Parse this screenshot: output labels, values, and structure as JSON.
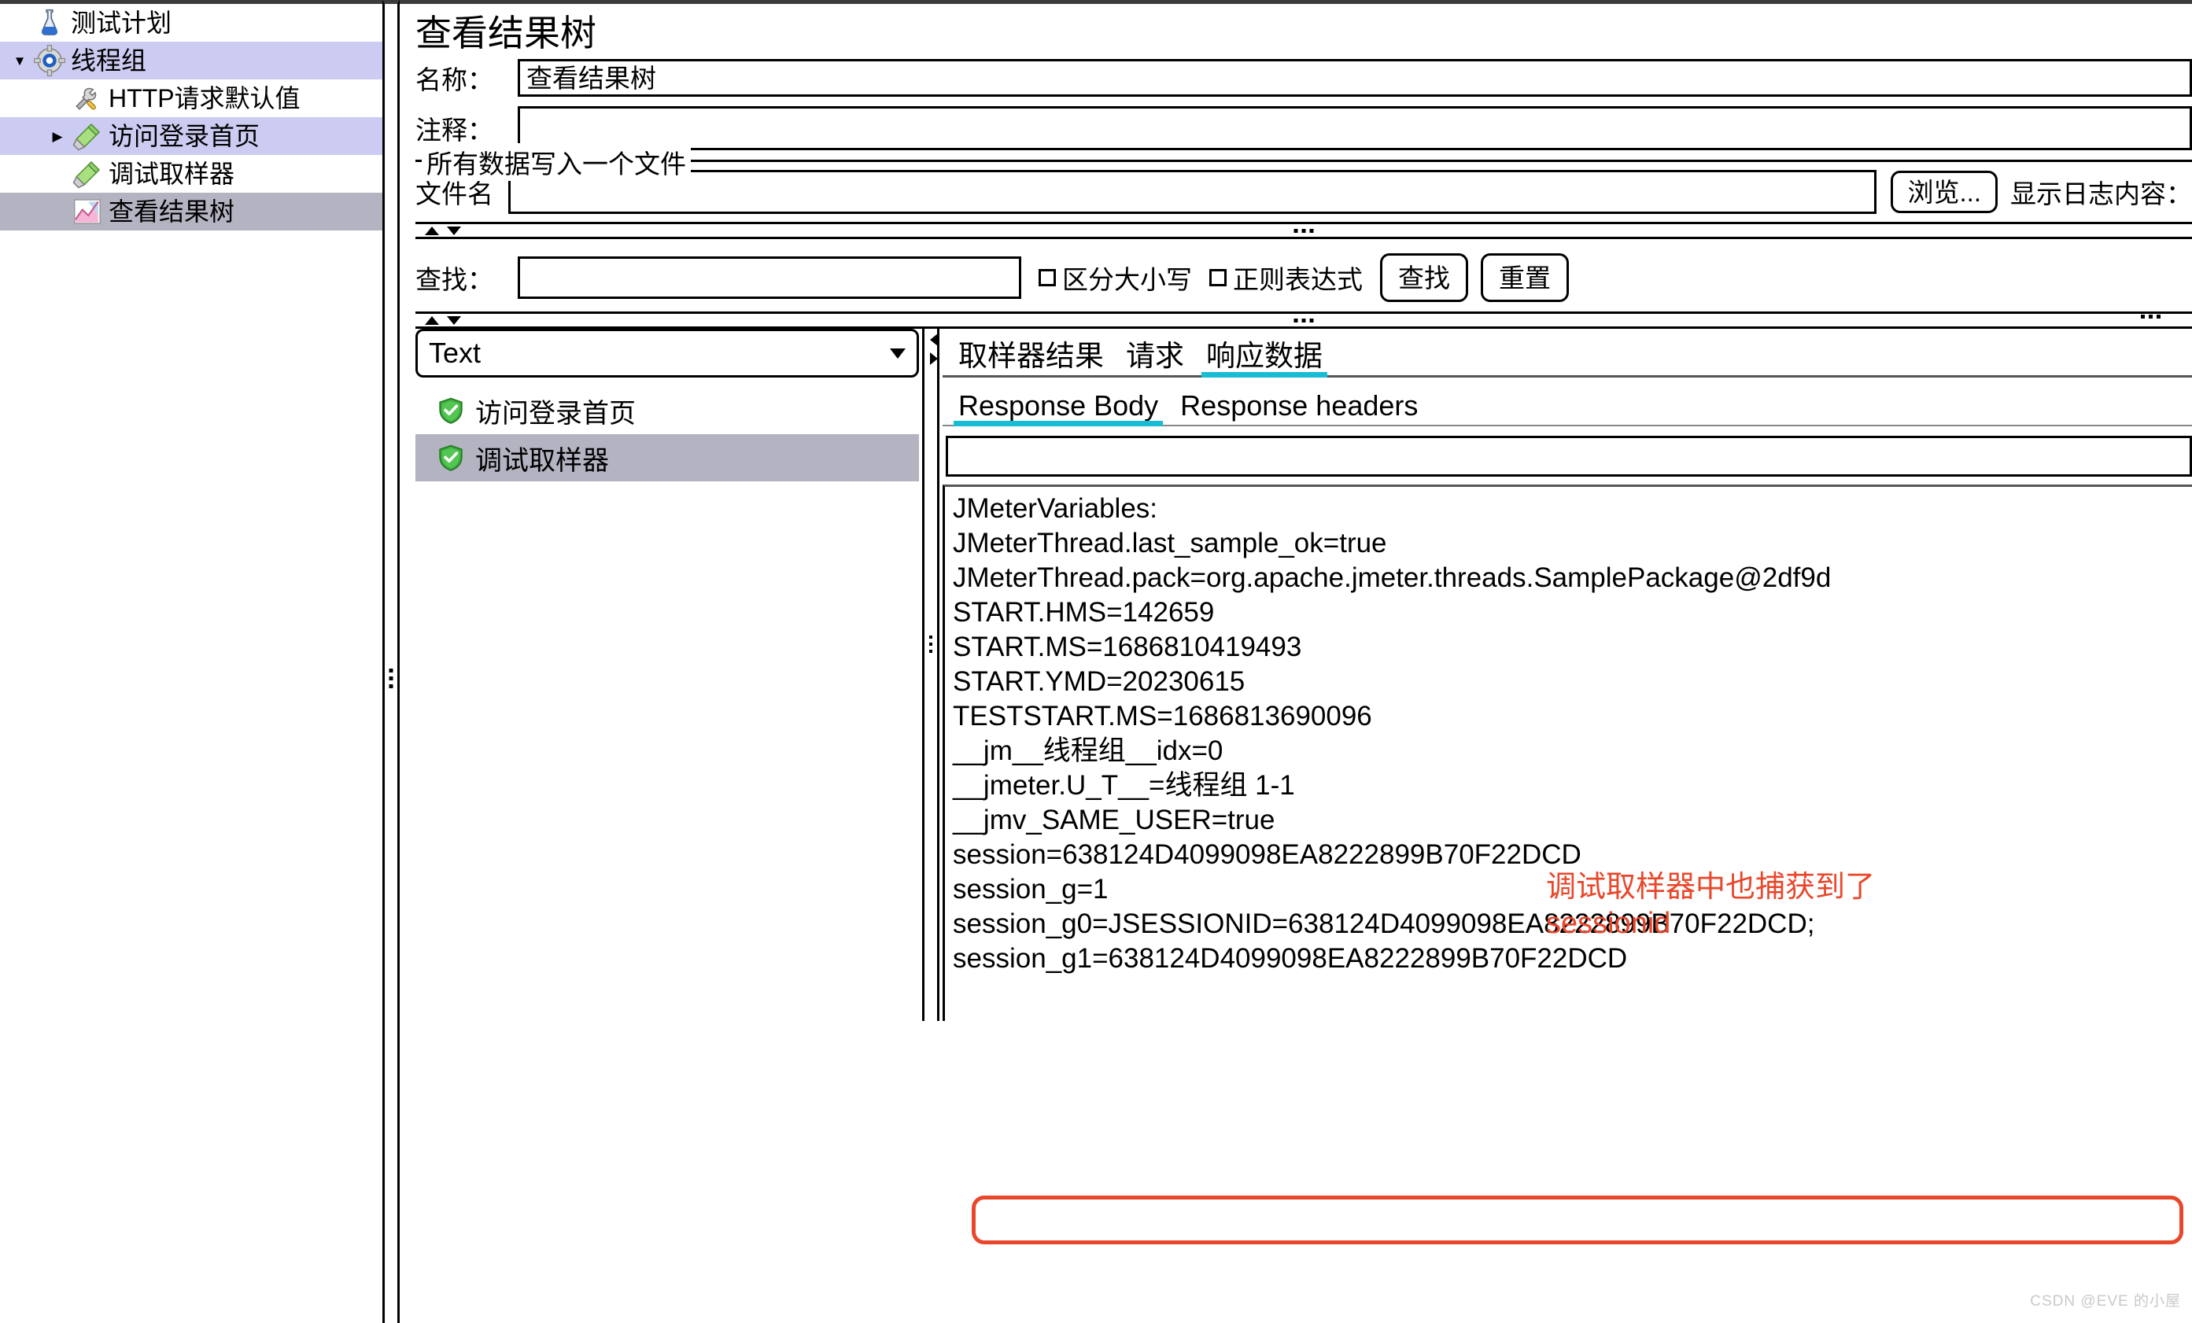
{
  "tree": {
    "items": [
      {
        "label": "测试计划",
        "icon": "test-plan-icon",
        "indent": 1,
        "toggle": "",
        "state": "none"
      },
      {
        "label": "线程组",
        "icon": "thread-group-icon",
        "indent": 1,
        "toggle": "▼",
        "state": "blue"
      },
      {
        "label": "HTTP请求默认值",
        "icon": "http-defaults-icon",
        "indent": 2,
        "toggle": "",
        "state": "none"
      },
      {
        "label": "访问登录首页",
        "icon": "sampler-icon",
        "indent": 2,
        "toggle": "▶",
        "state": "blue"
      },
      {
        "label": "调试取样器",
        "icon": "sampler-icon",
        "indent": 2,
        "toggle": "",
        "state": "none"
      },
      {
        "label": "查看结果树",
        "icon": "view-results-tree-icon",
        "indent": 2,
        "toggle": "",
        "state": "gray"
      }
    ]
  },
  "page": {
    "title": "查看结果树",
    "name_label": "名称：",
    "name_value": "查看结果树",
    "comment_label": "注释：",
    "comment_value": ""
  },
  "file_group": {
    "title": "所有数据写入一个文件",
    "filename_label": "文件名",
    "filename_value": "",
    "browse_label": "浏览...",
    "log_label": "显示日志内容："
  },
  "search": {
    "label": "查找：",
    "value": "",
    "case_sensitive_label": "区分大小写",
    "regex_label": "正则表达式",
    "find_button": "查找",
    "reset_button": "重置"
  },
  "renderer": {
    "selected": "Text"
  },
  "results": [
    {
      "label": "访问登录首页",
      "selected": false
    },
    {
      "label": "调试取样器",
      "selected": true
    }
  ],
  "tabs": {
    "main": [
      {
        "label": "取样器结果",
        "active": false
      },
      {
        "label": "请求",
        "active": false
      },
      {
        "label": "响应数据",
        "active": true
      }
    ],
    "sub": [
      {
        "label": "Response Body",
        "active": true
      },
      {
        "label": "Response headers",
        "active": false
      }
    ]
  },
  "response": {
    "search_value": "",
    "lines": [
      "JMeterVariables:",
      "JMeterThread.last_sample_ok=true",
      "JMeterThread.pack=org.apache.jmeter.threads.SamplePackage@2df9d",
      "START.HMS=142659",
      "START.MS=1686810419493",
      "START.YMD=20230615",
      "TESTSTART.MS=1686813690096",
      "__jm__线程组__idx=0",
      "__jmeter.U_T__=线程组 1-1",
      "__jmv_SAME_USER=true",
      "session=638124D4099098EA8222899B70F22DCD",
      "session_g=1",
      "session_g0=JSESSIONID=638124D4099098EA8222899B70F22DCD;",
      "session_g1=638124D4099098EA8222899B70F22DCD"
    ]
  },
  "annotation": {
    "text": "调试取样器中也捕获到了\nsessionid",
    "color": "#e8472b"
  },
  "highlight": {
    "color": "#e8472b"
  },
  "watermark": "CSDN @EVE 的小屋"
}
